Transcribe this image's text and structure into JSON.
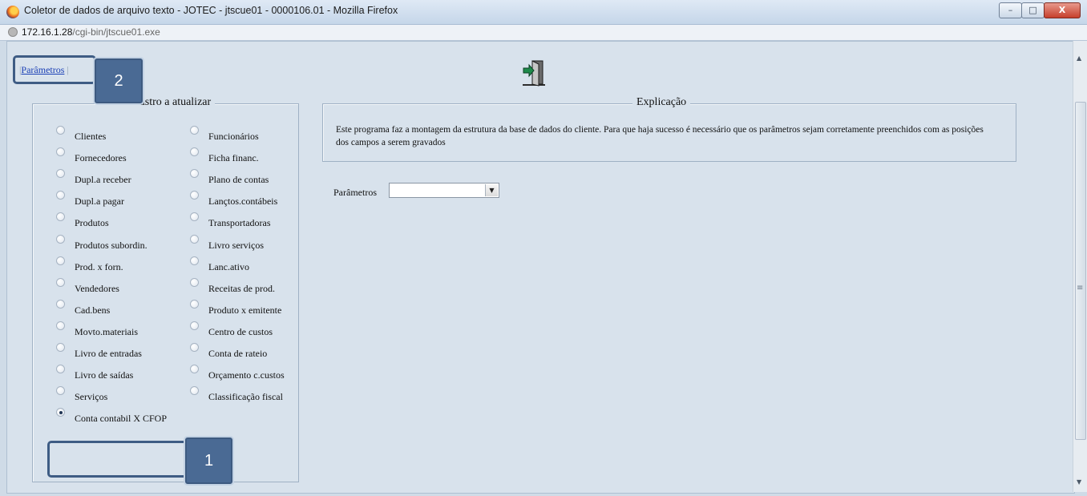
{
  "window": {
    "title": "Coletor de dados de arquivo texto - JOTEC - jtscue01 - 0000106.01 - Mozilla Firefox",
    "buttons": [
      "–",
      "□",
      "X"
    ]
  },
  "address": {
    "host": "172.16.1.28",
    "path": "/cgi-bin/jtscue01.exe"
  },
  "menu": {
    "link": "Parâmetros"
  },
  "cadastro": {
    "legend": "Cadastro a atualizar",
    "col1": [
      "Clientes",
      "Fornecedores",
      "Dupl.a receber",
      "Dupl.a pagar",
      "Produtos",
      "Produtos subordin.",
      "Prod. x forn.",
      "Vendedores",
      "Cad.bens",
      "Movto.materiais",
      "Livro de entradas",
      "Livro de saídas",
      "Serviços",
      "Conta contabil X CFOP"
    ],
    "col2": [
      "Funcionários",
      "Ficha financ.",
      "Plano de contas",
      "Lançtos.contábeis",
      "Transportadoras",
      "Livro serviços",
      "Lanc.ativo",
      "Receitas de prod.",
      "Produto x emitente",
      "Centro de custos",
      "Conta de rateio",
      "Orçamento c.custos",
      "Classificação fiscal"
    ],
    "selected": "Conta contabil X CFOP"
  },
  "explicacao": {
    "legend": "Explicação",
    "text": "Este programa faz a montagem da estrutura da base de dados do cliente. Para que haja sucesso é necessário que os parâmetros sejam corretamente preenchidos com as posições dos campos a serem gravados"
  },
  "parametros": {
    "label": "Parâmetros",
    "value": ""
  },
  "callouts": [
    "1",
    "2"
  ]
}
